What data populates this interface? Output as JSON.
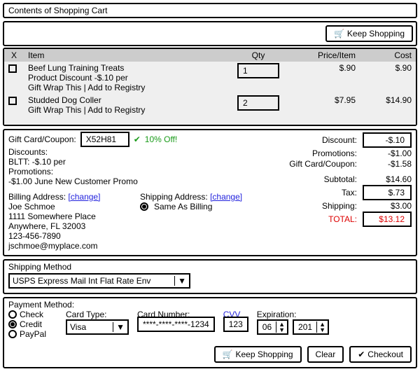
{
  "title": "Contents of Shopping Cart",
  "keep_shopping": "Keep Shopping",
  "table": {
    "h_x": "X",
    "h_item": "Item",
    "h_qty": "Qty",
    "h_price": "Price/Item",
    "h_cost": "Cost",
    "rows": [
      {
        "l1": "Beef Lung Training Treats",
        "l2": "Product Discount -$.10 per",
        "l3": "Gift Wrap This | Add to Registry",
        "qty": "1",
        "price": "$.90",
        "cost": "$.90"
      },
      {
        "l1": "Studded Dog Coller",
        "l2": "Gift Wrap This | Add to Registry",
        "l3": "",
        "qty": "2",
        "price": "$7.95",
        "cost": "$14.90"
      }
    ]
  },
  "coupon": {
    "label": "Gift Card/Coupon:",
    "code": "X52H81",
    "msg": "10% Off!"
  },
  "disc_label": "Discounts:",
  "disc_line": "BLTT: -$.10 per",
  "promo_label": "Promotions:",
  "promo_line": "-$1.00 June New Customer Promo",
  "billing": {
    "title": "Billing Address:",
    "change": "[change]",
    "l1": "Joe Schmoe",
    "l2": "1111 Somewhere Place",
    "l3": "Anywhere, FL 32003",
    "l4": "123-456-7890",
    "l5": "jschmoe@myplace.com"
  },
  "shipping": {
    "title": "Shipping Address:",
    "change": "[change]",
    "same": "Same As Billing"
  },
  "totals": {
    "discount_l": "Discount:",
    "discount_v": "-$.10",
    "promo_l": "Promotions:",
    "promo_v": "-$1.00",
    "gc_l": "Gift Card/Coupon:",
    "gc_v": "-$1.58",
    "sub_l": "Subtotal:",
    "sub_v": "$14.60",
    "tax_l": "Tax:",
    "tax_v": "$.73",
    "ship_l": "Shipping:",
    "ship_v": "$3.00",
    "total_l": "TOTAL:",
    "total_v": "$13.12"
  },
  "shipmethod": {
    "title": "Shipping Method",
    "value": "USPS Express Mail Int Flat Rate Env"
  },
  "pay": {
    "title": "Payment Method:",
    "check": "Check",
    "credit": "Credit",
    "paypal": "PayPal",
    "cardtype_l": "Card Type:",
    "cardtype_v": "Visa",
    "cardnum_l": "Card Number:",
    "cardnum_v": "****-****-****-1234",
    "cvv_l": "CVV",
    "cvv_v": "123",
    "exp_l": "Expiration:",
    "exp_m": "06",
    "exp_y": "201"
  },
  "buttons": {
    "clear": "Clear",
    "checkout": "Checkout"
  }
}
